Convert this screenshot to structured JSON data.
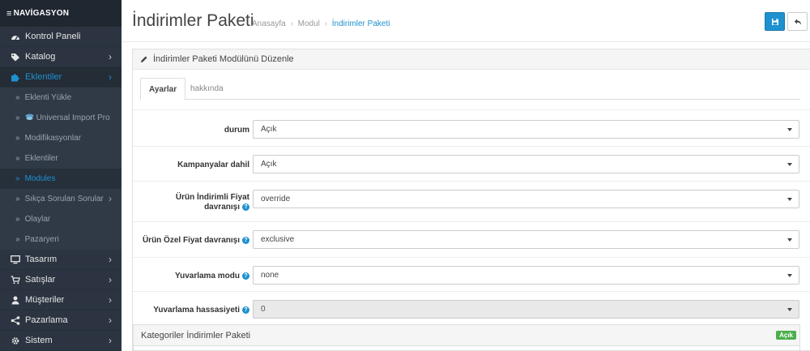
{
  "sidebar": {
    "header": "NAVİGASYON",
    "items": [
      {
        "label": "Kontrol Paneli",
        "icon": "dashboard-icon",
        "chevron": false
      },
      {
        "label": "Katalog",
        "icon": "tag-icon",
        "chevron": true
      },
      {
        "label": "Eklentiler",
        "icon": "puzzle-icon",
        "chevron": true,
        "active": true
      }
    ],
    "subitems": [
      {
        "label": "Eklenti Yükle"
      },
      {
        "label": "Universal Import Pro"
      },
      {
        "label": "Modifikasyonlar"
      },
      {
        "label": "Eklentiler"
      },
      {
        "label": "Modules",
        "active": true
      },
      {
        "label": "Sıkça Sorulan Sorular",
        "chevron": true
      },
      {
        "label": "Olaylar"
      },
      {
        "label": "Pazaryeri"
      }
    ],
    "items_after": [
      {
        "label": "Tasarım",
        "icon": "monitor-icon"
      },
      {
        "label": "Satışlar",
        "icon": "cart-icon"
      },
      {
        "label": "Müşteriler",
        "icon": "user-icon"
      },
      {
        "label": "Pazarlama",
        "icon": "share-icon"
      },
      {
        "label": "Sistem",
        "icon": "gear-icon"
      }
    ]
  },
  "header": {
    "title": "İndirimler Paketi",
    "breadcrumb": [
      "Anasayfa",
      "Modul",
      "İndirimler Paketi"
    ]
  },
  "panel": {
    "heading": "İndirimler Paketi Modülünü Düzenle",
    "tabs": [
      "Ayarlar",
      "hakkında"
    ]
  },
  "form": {
    "rows": [
      {
        "label": "durum",
        "value": "Açık",
        "help": false
      },
      {
        "label": "Kampanyalar dahil",
        "value": "Açık",
        "help": false
      },
      {
        "label_line1": "Ürün İndirimli Fiyat",
        "label_line2": "davranışı",
        "value": "override",
        "help": true
      },
      {
        "label": "Ürün Özel Fiyat davranışı",
        "value": "exclusive",
        "help": true
      },
      {
        "label": "Yuvarlama modu",
        "value": "none",
        "help": true
      },
      {
        "label": "Yuvarlama hassasiyeti",
        "value": "0",
        "help": true,
        "disabled": true
      }
    ]
  },
  "categories_panel": {
    "heading": "Kategoriler İndirimler Paketi",
    "badge": "Açık"
  },
  "colors": {
    "accent": "#1e91cf",
    "sidebar_bg": "#2b3440",
    "badge_green": "#4cae4c"
  }
}
